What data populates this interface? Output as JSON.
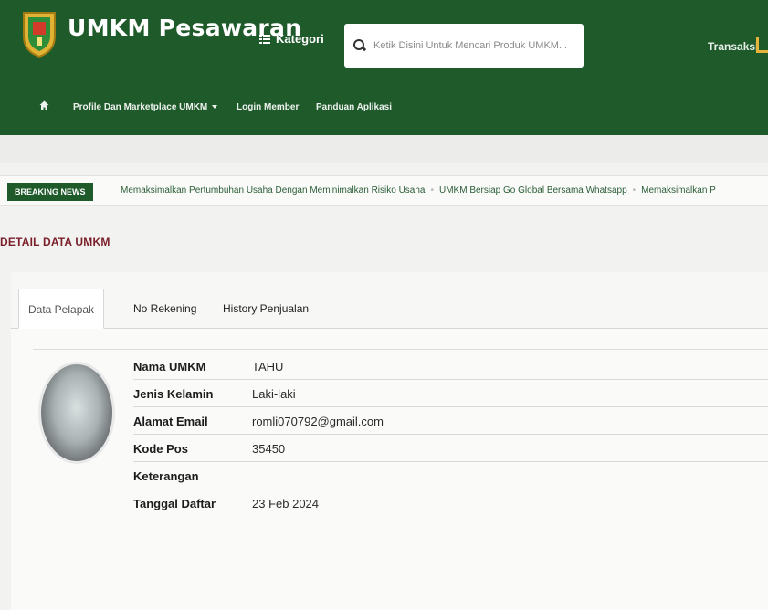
{
  "header": {
    "brand": "UMKM Pesawaran",
    "kategori_label": "Kategori",
    "search_placeholder": "Ketik Disini Untuk Mencari Produk UMKM...",
    "transaksi_label": "Transaksi"
  },
  "nav": {
    "items": [
      {
        "label": "Profile Dan Marketplace UMKM"
      },
      {
        "label": "Login Member"
      },
      {
        "label": "Panduan Aplikasi"
      }
    ]
  },
  "breaking": {
    "label": "BREAKING NEWS",
    "items": [
      "Memaksimalkan Pertumbuhan Usaha Dengan Meminimalkan Risiko Usaha",
      "UMKM Bersiap Go Global Bersama Whatsapp",
      "Memaksimalkan P"
    ]
  },
  "page": {
    "title": "DETAIL DATA UMKM"
  },
  "tabs": [
    {
      "label": "Data Pelapak",
      "active": true
    },
    {
      "label": "No Rekening",
      "active": false
    },
    {
      "label": "History Penjualan",
      "active": false
    }
  ],
  "details": [
    {
      "label": "Nama UMKM",
      "value": "TAHU"
    },
    {
      "label": "Jenis Kelamin",
      "value": "Laki-laki"
    },
    {
      "label": "Alamat Email",
      "value": "romli070792@gmail.com"
    },
    {
      "label": "Kode Pos",
      "value": "35450"
    },
    {
      "label": "Keterangan",
      "value": ""
    },
    {
      "label": "Tanggal Daftar",
      "value": "23 Feb 2024"
    }
  ],
  "colors": {
    "primary_green": "#1f5a2b",
    "title_maroon": "#7a1f2a",
    "accent_yellow": "#e6b43a"
  }
}
